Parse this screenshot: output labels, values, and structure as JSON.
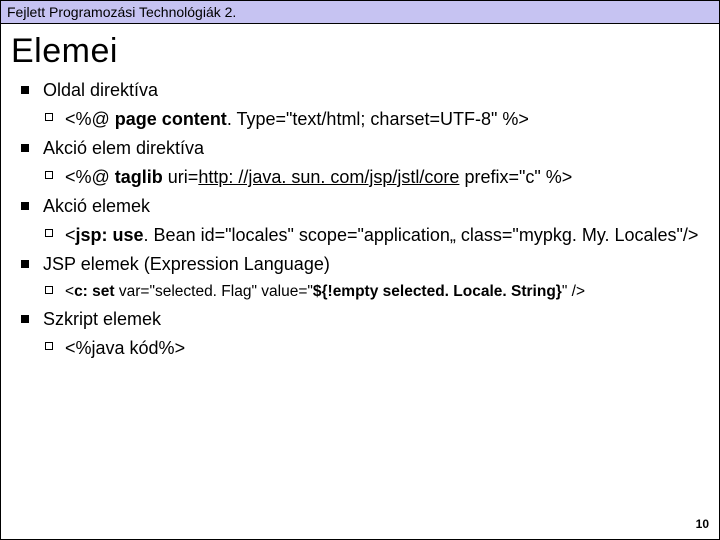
{
  "header": "Fejlett Programozási Technológiák 2.",
  "title": "Elemei",
  "items": [
    {
      "label": "Oldal direktíva",
      "sub": [
        {
          "prefix": "<%@ ",
          "bold1": "page content",
          "mid": ". Type=\"text/html; charset=UTF-8\" %>"
        }
      ]
    },
    {
      "label": "Akció elem direktíva",
      "sub": [
        {
          "prefix": "<%@ ",
          "bold1": "taglib",
          "mid": " uri=",
          "link": "http: //java. sun. com/jsp/jstl/core",
          "after": " prefix=\"c\" %>"
        }
      ]
    },
    {
      "label": "Akció elemek",
      "sub": [
        {
          "prefix": "<",
          "bold1": "jsp: use",
          "mid": ". Bean id=\"locales\" scope=\"application„ class=\"mypkg. My. Locales\"/>"
        }
      ]
    },
    {
      "label": "JSP elemek (Expression Language)",
      "sub": [
        {
          "small": true,
          "prefix": "<",
          "bold1": "c: set",
          "mid": " var=\"selected. Flag\" value=\"",
          "bold2": "${!empty selected. Locale. String}",
          "after": "\" />"
        }
      ]
    },
    {
      "label": "Szkript elemek",
      "sub": [
        {
          "prefix": "<%java kód%>"
        }
      ]
    }
  ],
  "page_number": "10"
}
